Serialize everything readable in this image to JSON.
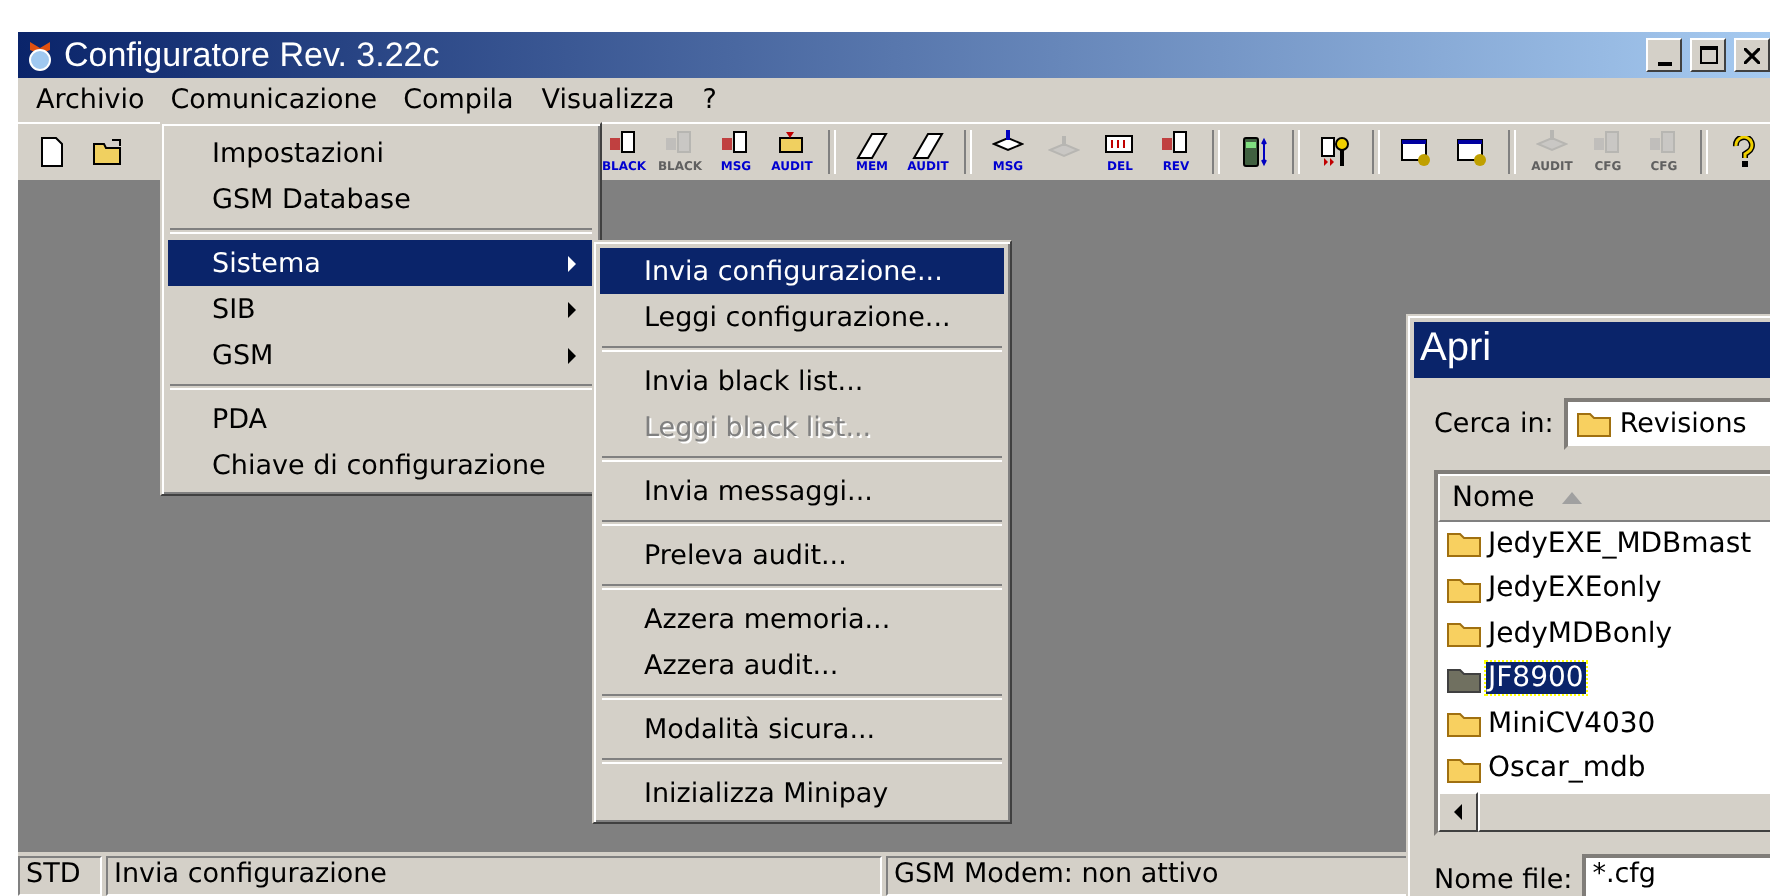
{
  "window": {
    "title": "Configuratore Rev. 3.22c"
  },
  "menu_bar": [
    {
      "label": "Archivio",
      "selected": false
    },
    {
      "label": "Comunicazione",
      "selected": true
    },
    {
      "label": "Compila",
      "selected": false
    },
    {
      "label": "Visualizza",
      "selected": false
    },
    {
      "label": "?",
      "selected": false
    }
  ],
  "toolbar": [
    {
      "kind": "new",
      "disabled": false
    },
    {
      "kind": "open",
      "disabled": false
    },
    {
      "kind": "gap"
    },
    {
      "kind": "doc",
      "caption": "BLACK",
      "disabled": false
    },
    {
      "kind": "doc",
      "caption": "BLACK",
      "disabled": true
    },
    {
      "kind": "doc",
      "caption": "MSG",
      "disabled": false
    },
    {
      "kind": "folder",
      "caption": "AUDIT",
      "disabled": false
    },
    {
      "kind": "separator"
    },
    {
      "kind": "erase",
      "caption": "MEM",
      "disabled": false
    },
    {
      "kind": "erase",
      "caption": "AUDIT",
      "disabled": false
    },
    {
      "kind": "separator"
    },
    {
      "kind": "stack",
      "caption": "MSG",
      "disabled": false
    },
    {
      "kind": "stack",
      "disabled": true
    },
    {
      "kind": "grid",
      "caption": "DEL",
      "disabled": false
    },
    {
      "kind": "doc",
      "caption": "REV",
      "disabled": false
    },
    {
      "kind": "separator"
    },
    {
      "kind": "device",
      "disabled": false
    },
    {
      "kind": "separator"
    },
    {
      "kind": "key",
      "disabled": false
    },
    {
      "kind": "separator"
    },
    {
      "kind": "window",
      "disabled": false
    },
    {
      "kind": "window",
      "disabled": false
    },
    {
      "kind": "separator"
    },
    {
      "kind": "stack",
      "caption": "AUDIT",
      "disabled": true
    },
    {
      "kind": "doc",
      "caption": "CFG",
      "disabled": true
    },
    {
      "kind": "doc",
      "caption": "CFG",
      "disabled": true
    },
    {
      "kind": "separator"
    },
    {
      "kind": "help",
      "disabled": false
    }
  ],
  "menu": [
    {
      "kind": "item",
      "label": "Impostazioni",
      "submenu": false,
      "selected": false,
      "disabled": false
    },
    {
      "kind": "item",
      "label": "GSM Database",
      "submenu": false,
      "selected": false,
      "disabled": false
    },
    {
      "kind": "separator"
    },
    {
      "kind": "item",
      "label": "Sistema",
      "submenu": true,
      "selected": true,
      "disabled": false
    },
    {
      "kind": "item",
      "label": "SIB",
      "submenu": true,
      "selected": false,
      "disabled": false
    },
    {
      "kind": "item",
      "label": "GSM",
      "submenu": true,
      "selected": false,
      "disabled": false
    },
    {
      "kind": "separator"
    },
    {
      "kind": "item",
      "label": "PDA",
      "submenu": false,
      "selected": false,
      "disabled": false
    },
    {
      "kind": "item",
      "label": "Chiave di configurazione",
      "submenu": false,
      "selected": false,
      "disabled": false
    }
  ],
  "submenu": [
    {
      "kind": "item",
      "label": "Invia configurazione...",
      "selected": true,
      "disabled": false
    },
    {
      "kind": "item",
      "label": "Leggi configurazione...",
      "selected": false,
      "disabled": false
    },
    {
      "kind": "separator"
    },
    {
      "kind": "item",
      "label": "Invia black list...",
      "selected": false,
      "disabled": false
    },
    {
      "kind": "item",
      "label": "Leggi black list...",
      "selected": false,
      "disabled": true
    },
    {
      "kind": "separator"
    },
    {
      "kind": "item",
      "label": "Invia messaggi...",
      "selected": false,
      "disabled": false
    },
    {
      "kind": "separator"
    },
    {
      "kind": "item",
      "label": "Preleva audit...",
      "selected": false,
      "disabled": false
    },
    {
      "kind": "separator"
    },
    {
      "kind": "item",
      "label": "Azzera memoria...",
      "selected": false,
      "disabled": false
    },
    {
      "kind": "item",
      "label": "Azzera audit...",
      "selected": false,
      "disabled": false
    },
    {
      "kind": "separator"
    },
    {
      "kind": "item",
      "label": "Modalità sicura...",
      "selected": false,
      "disabled": false
    },
    {
      "kind": "separator"
    },
    {
      "kind": "item",
      "label": "Inizializza Minipay",
      "selected": false,
      "disabled": false
    }
  ],
  "dialog": {
    "title": "Apri",
    "look_in_label": "Cerca in:",
    "look_in_value": "Revisions",
    "column": "Nome",
    "files": [
      {
        "name": "JedyEXE_MDBmast",
        "selected": false
      },
      {
        "name": "JedyEXEonly",
        "selected": false
      },
      {
        "name": "JedyMDBonly",
        "selected": false
      },
      {
        "name": "JF8900",
        "selected": true
      },
      {
        "name": "MiniCV4030",
        "selected": false
      },
      {
        "name": "Oscar_mdb",
        "selected": false
      }
    ],
    "filename_label": "Nome file:",
    "filename_value": "*.cfg"
  },
  "status_bar": [
    "STD",
    "Invia configurazione",
    "GSM Modem: non attivo"
  ]
}
